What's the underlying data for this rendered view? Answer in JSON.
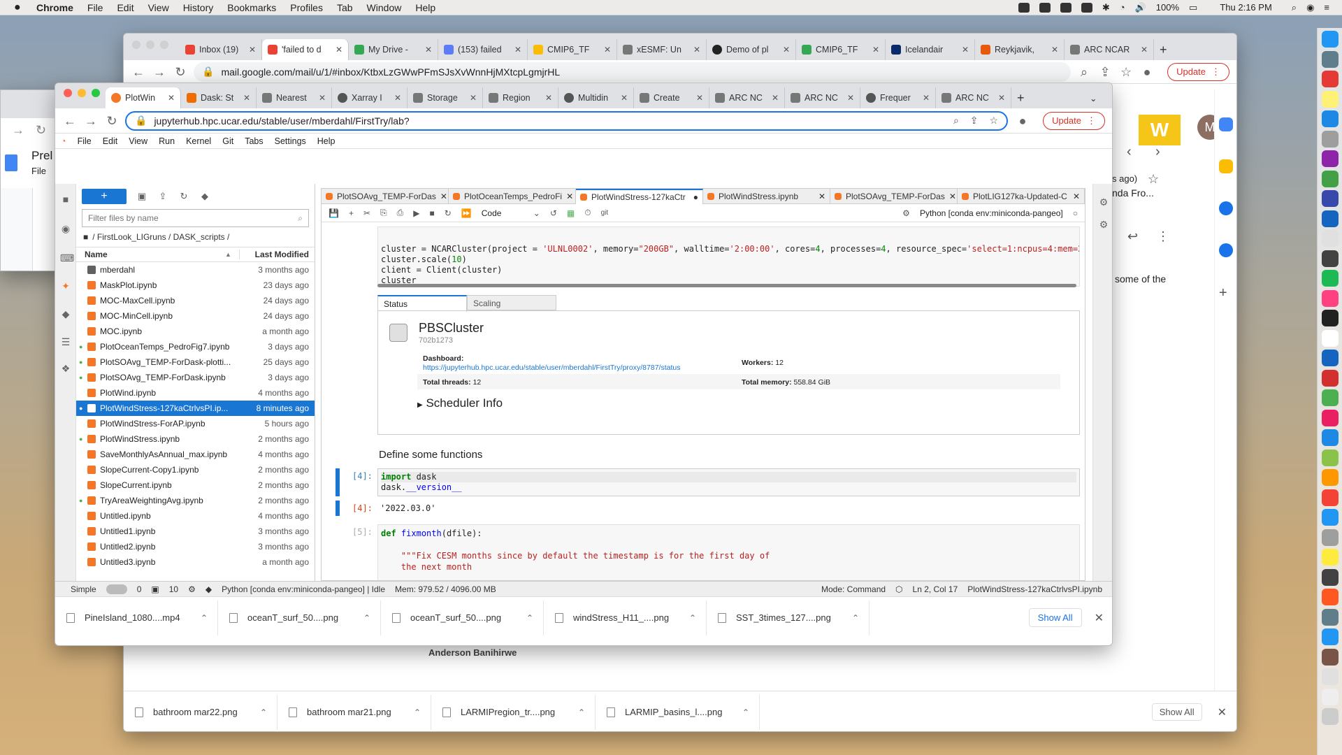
{
  "menubar": {
    "app": "Chrome",
    "items": [
      "File",
      "Edit",
      "View",
      "History",
      "Bookmarks",
      "Profiles",
      "Tab",
      "Window",
      "Help"
    ],
    "battery": "100%",
    "clock": "Thu 2:16 PM"
  },
  "gmail_window": {
    "tabs": [
      "Inbox (19)",
      "'failed to d",
      "My Drive -",
      "(153) failed",
      "CMIP6_TF",
      "xESMF: Un",
      "Demo of pl",
      "CMIP6_TF",
      "Icelandair",
      "Reykjavik,",
      "ARC NCAR"
    ],
    "url": "mail.google.com/mail/u/1/#inbox/KtbxLzGWwPFmSJsXvWnnHjMXtcpLgmjrHL",
    "update_label": "Update",
    "snippet_ago": "s ago)",
    "snippet_from": "nda Fro...",
    "snippet_body": "some of the",
    "signature": "Anderson Banihirwe",
    "avatar": "M",
    "downloads": [
      "bathroom mar22.png",
      "bathroom mar21.png",
      "LARMIPregion_tr....png",
      "LARMIP_basins_l....png"
    ],
    "show_all": "Show All"
  },
  "docs_window": {
    "title": "Prel",
    "menu": "File"
  },
  "jupyter_window": {
    "tabs": [
      "PlotWin",
      "Dask: St",
      "Nearest",
      "Xarray I",
      "Storage",
      "Region",
      "Multidin",
      "Create",
      "ARC NC",
      "ARC NC",
      "Frequer",
      "ARC NC"
    ],
    "url": "jupyterhub.hpc.ucar.edu/stable/user/mberdahl/FirstTry/lab?",
    "update_label": "Update",
    "menu": [
      "File",
      "Edit",
      "View",
      "Run",
      "Kernel",
      "Git",
      "Tabs",
      "Settings",
      "Help"
    ],
    "filter_placeholder": "Filter files by name",
    "breadcrumb": "/ FirstLook_LIGruns / DASK_scripts /",
    "col_name": "Name",
    "col_modified": "Last Modified",
    "files": [
      {
        "name": "mberdahl",
        "mod": "3 months ago",
        "type": "folder",
        "running": false
      },
      {
        "name": "MaskPlot.ipynb",
        "mod": "23 days ago",
        "type": "nb",
        "running": false
      },
      {
        "name": "MOC-MaxCell.ipynb",
        "mod": "24 days ago",
        "type": "nb",
        "running": false
      },
      {
        "name": "MOC-MinCell.ipynb",
        "mod": "24 days ago",
        "type": "nb",
        "running": false
      },
      {
        "name": "MOC.ipynb",
        "mod": "a month ago",
        "type": "nb",
        "running": false
      },
      {
        "name": "PlotOceanTemps_PedroFig7.ipynb",
        "mod": "3 days ago",
        "type": "nb",
        "running": true
      },
      {
        "name": "PlotSOAvg_TEMP-ForDask-plotti...",
        "mod": "25 days ago",
        "type": "nb",
        "running": true
      },
      {
        "name": "PlotSOAvg_TEMP-ForDask.ipynb",
        "mod": "3 days ago",
        "type": "nb",
        "running": true
      },
      {
        "name": "PlotWind.ipynb",
        "mod": "4 months ago",
        "type": "nb",
        "running": false
      },
      {
        "name": "PlotWindStress-127kaCtrlvsPI.ip...",
        "mod": "8 minutes ago",
        "type": "nb",
        "running": true,
        "selected": true
      },
      {
        "name": "PlotWindStress-ForAP.ipynb",
        "mod": "5 hours ago",
        "type": "nb",
        "running": false
      },
      {
        "name": "PlotWindStress.ipynb",
        "mod": "2 months ago",
        "type": "nb",
        "running": true
      },
      {
        "name": "SaveMonthlyAsAnnual_max.ipynb",
        "mod": "4 months ago",
        "type": "nb",
        "running": false
      },
      {
        "name": "SlopeCurrent-Copy1.ipynb",
        "mod": "2 months ago",
        "type": "nb",
        "running": false
      },
      {
        "name": "SlopeCurrent.ipynb",
        "mod": "2 months ago",
        "type": "nb",
        "running": false
      },
      {
        "name": "TryAreaWeightingAvg.ipynb",
        "mod": "2 months ago",
        "type": "nb",
        "running": true
      },
      {
        "name": "Untitled.ipynb",
        "mod": "4 months ago",
        "type": "nb",
        "running": false
      },
      {
        "name": "Untitled1.ipynb",
        "mod": "3 months ago",
        "type": "nb",
        "running": false
      },
      {
        "name": "Untitled2.ipynb",
        "mod": "3 months ago",
        "type": "nb",
        "running": false
      },
      {
        "name": "Untitled3.ipynb",
        "mod": "a month ago",
        "type": "nb",
        "running": false
      }
    ],
    "nb_tabs": [
      "PlotSOAvg_TEMP-ForDas",
      "PlotOceanTemps_PedroFi",
      "PlotWindStress-127kaCtr",
      "PlotWindStress.ipynb",
      "PlotSOAvg_TEMP-ForDas",
      "PlotLIG127ka-Updated-C"
    ],
    "cell_type": "Code",
    "git_label": "git",
    "kernel": "Python [conda env:miniconda-pangeo]",
    "cluster_widget": {
      "tab_status": "Status",
      "tab_scaling": "Scaling",
      "name": "PBSCluster",
      "id": "702b1273",
      "dashboard_label": "Dashboard:",
      "dashboard_url": "https://jupyterhub.hpc.ucar.edu/stable/user/mberdahl/FirstTry/proxy/8787/status",
      "workers_label": "Workers:",
      "workers": "12",
      "threads_label": "Total threads:",
      "threads": "12",
      "memory_label": "Total memory:",
      "memory": "558.84 GiB",
      "scheduler": "Scheduler Info"
    },
    "markdown_heading": "Define some functions",
    "prompt4": "[4]:",
    "output4": "'2022.03.0'",
    "prompt5": "[5]:",
    "status": {
      "mode": "Simple",
      "c0": "0",
      "c1": "10",
      "kernel": "Python [conda env:miniconda-pangeo] | Idle",
      "mem": "Mem: 979.52 / 4096.00 MB",
      "cmd": "Mode: Command",
      "pos": "Ln 2, Col 17",
      "file": "PlotWindStress-127kaCtrlvsPI.ipynb"
    },
    "downloads": [
      "PineIsland_1080....mp4",
      "oceanT_surf_50....png",
      "oceanT_surf_50....png",
      "windStress_H11_....png",
      "SST_3times_127....png"
    ],
    "show_all": "Show All"
  }
}
